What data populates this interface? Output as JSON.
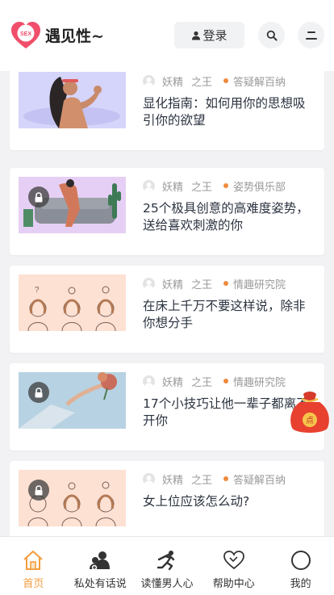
{
  "header": {
    "brand": "遇见性~",
    "logo_text": "SEX",
    "login_label": "登录"
  },
  "articles": [
    {
      "author_a": "妖精",
      "author_b": "之王",
      "category": "答疑解百纳",
      "title": "显化指南：如何用你的思想吸引你的欲望",
      "locked": false
    },
    {
      "author_a": "妖精",
      "author_b": "之王",
      "category": "姿势俱乐部",
      "title": "25个极具创意的高难度姿势，送给喜欢刺激的你",
      "locked": true
    },
    {
      "author_a": "妖精",
      "author_b": "之王",
      "category": "情趣研究院",
      "title": "在床上千万不要这样说，除非你想分手",
      "locked": false
    },
    {
      "author_a": "妖精",
      "author_b": "之王",
      "category": "情趣研究院",
      "title": "17个小技巧让他一辈子都离不开你",
      "locked": true
    },
    {
      "author_a": "妖精",
      "author_b": "之王",
      "category": "答疑解百纳",
      "title": "女上位应该怎么动?",
      "locked": true
    }
  ],
  "redbag_text": "点",
  "tabs": [
    {
      "label": "首页",
      "icon": "home-icon",
      "active": true
    },
    {
      "label": "私处有话说",
      "icon": "users-icon",
      "active": false
    },
    {
      "label": "读懂男人心",
      "icon": "runner-icon",
      "active": false
    },
    {
      "label": "帮助中心",
      "icon": "heart-icon",
      "active": false
    },
    {
      "label": "我的",
      "icon": "profile-circle-icon",
      "active": false
    }
  ],
  "colors": {
    "accent": "#f39c3d",
    "category_dot": "#f08a3c",
    "logo": "#f04e6b"
  }
}
